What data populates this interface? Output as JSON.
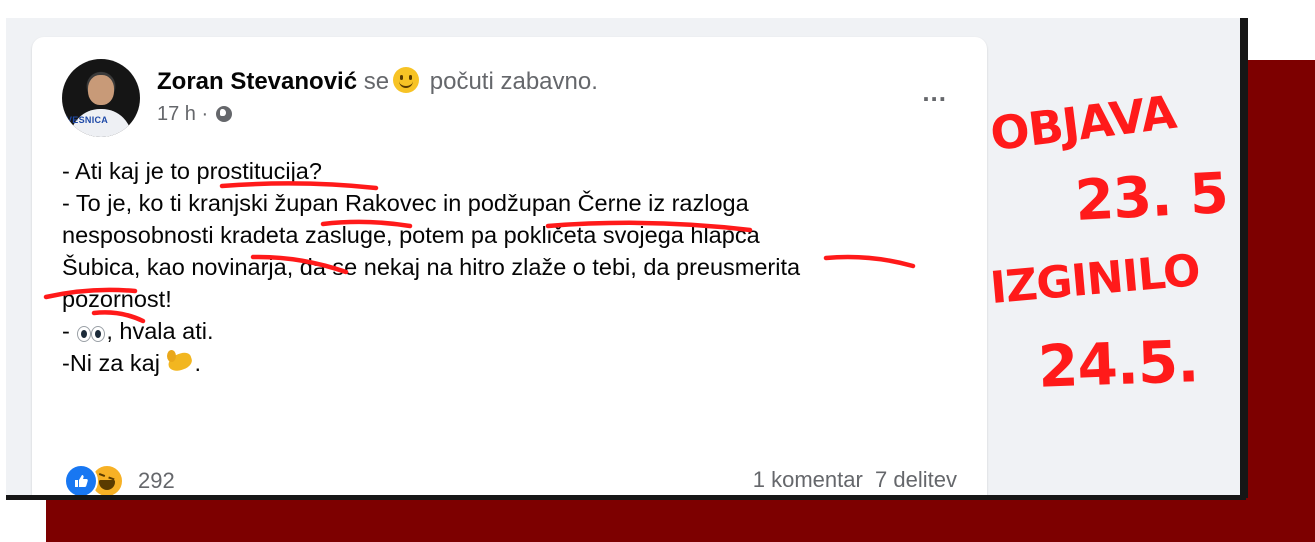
{
  "post": {
    "author": "Zoran Stevanović",
    "activity_prefix": "se",
    "activity_text": "počuti zabavno.",
    "timestamp": "17 h",
    "separator": "·",
    "more_icon": "...",
    "avatar_text": "VESNICA",
    "lines": {
      "line1_a": "- Ati kaj je to",
      "line1_b": " prostitucija",
      "line1_c": "?",
      "line2_a": "- To je, ko ti kranjski ",
      "line2_b": "župan",
      "line2_c": " Rakovec in ",
      "line2_d": "podžupan",
      "line2_e": " Černe iz razloga",
      "line3_a": "nesposobnosti ",
      "line3_b": "kradeta",
      "line3_c": " zasluge, potem pa pokličeta svojega ",
      "line3_d": "hlapca",
      "line4_a": "Šubica",
      "line4_b": ", kao novinarja, da se nekaj na hitro zlaže o tebi, da preusmerita",
      "line5": "pozornost!",
      "line6_a": "- ",
      "line6_b": ", hvala ati.",
      "line7": "-Ni za kaj "
    },
    "emojis": {
      "smile": "smile-emoji",
      "eyes": "eyes-emoji",
      "muscle": "muscle-emoji"
    },
    "reactions": {
      "icons": [
        "like-icon",
        "haha-icon"
      ],
      "count": "292"
    },
    "comments": "1 komentar",
    "shares": "7 delitev"
  },
  "annotations": {
    "color": "#ff1a1a",
    "line1": "OBJAVA",
    "line2": "23. 5",
    "line3": "IZGINILO",
    "line4": "24.5."
  },
  "colors": {
    "frame_red": "#7d0000",
    "card_bg": "#ffffff",
    "panel_bg": "#f0f2f5",
    "link_blue": "#1877f2"
  }
}
